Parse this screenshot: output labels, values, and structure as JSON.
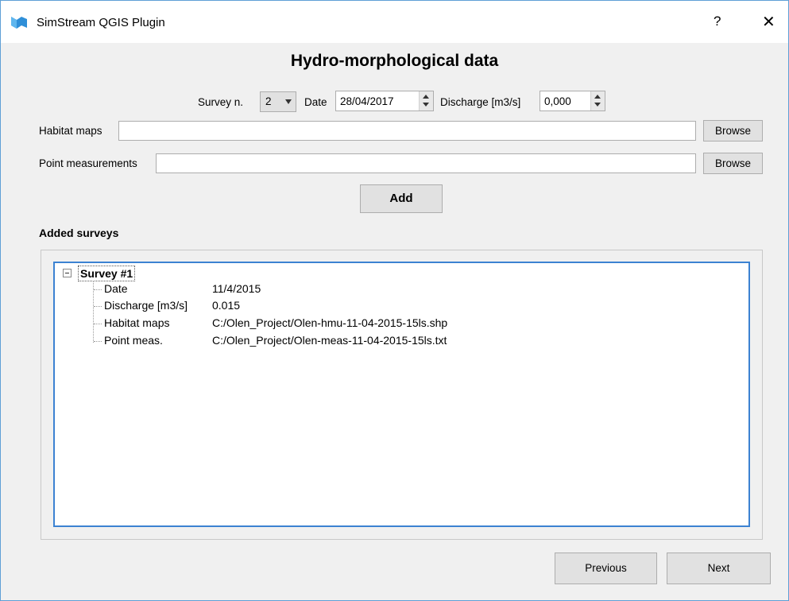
{
  "window": {
    "title": "SimStream QGIS Plugin",
    "help": "?",
    "close": "✕"
  },
  "heading": "Hydro-morphological data",
  "survey": {
    "survey_label": "Survey n.",
    "survey_value": "2",
    "date_label": "Date",
    "date_value": "28/04/2017",
    "discharge_label": "Discharge [m3/s]",
    "discharge_value": "0,000"
  },
  "fields": {
    "habitat_label": "Habitat maps",
    "habitat_value": "",
    "point_label": "Point measurements",
    "point_value": "",
    "browse_label": "Browse"
  },
  "add_label": "Add",
  "added_surveys_label": "Added surveys",
  "tree": {
    "root": "Survey #1",
    "rows": [
      {
        "key": "Date",
        "value": "11/4/2015"
      },
      {
        "key": "Discharge [m3/s]",
        "value": "0.015"
      },
      {
        "key": "Habitat maps",
        "value": "C:/Olen_Project/Olen-hmu-11-04-2015-15ls.shp"
      },
      {
        "key": "Point meas.",
        "value": "C:/Olen_Project/Olen-meas-11-04-2015-15ls.txt"
      }
    ]
  },
  "nav": {
    "previous": "Previous",
    "next": "Next"
  },
  "colors": {
    "accent": "#3c82d2",
    "icon": "#2f8fd8"
  }
}
